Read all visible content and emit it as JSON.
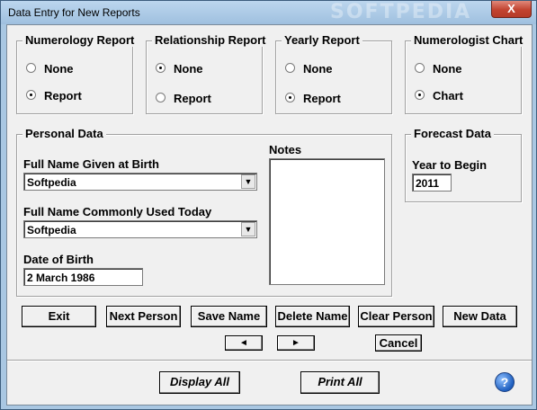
{
  "window": {
    "title": "Data Entry for New Reports",
    "watermark": "SOFTPEDIA",
    "close_glyph": "X"
  },
  "groups": {
    "numerology": {
      "legend": "Numerology Report",
      "options": [
        "None",
        "Report"
      ],
      "selected": "Report"
    },
    "relationship": {
      "legend": "Relationship Report",
      "options": [
        "None",
        "Report"
      ],
      "selected": "None"
    },
    "yearly": {
      "legend": "Yearly Report",
      "options": [
        "None",
        "Report"
      ],
      "selected": "Report"
    },
    "chart": {
      "legend": "Numerologist Chart",
      "options": [
        "None",
        "Chart"
      ],
      "selected": "Chart"
    }
  },
  "personal": {
    "legend": "Personal Data",
    "birth_name_label": "Full Name Given at Birth",
    "birth_name_value": "Softpedia",
    "common_name_label": "Full Name Commonly Used Today",
    "common_name_value": "Softpedia",
    "dob_label": "Date of Birth",
    "dob_value": "2 March 1986",
    "notes_label": "Notes",
    "notes_value": ""
  },
  "forecast": {
    "legend": "Forecast Data",
    "year_label": "Year to Begin",
    "year_value": "2011"
  },
  "buttons": {
    "exit": "Exit",
    "next_person": "Next Person",
    "save_name": "Save Name",
    "delete_name": "Delete Name",
    "clear_person": "Clear Person",
    "new_data": "New Data",
    "prev_arrow": "◄",
    "next_arrow": "►",
    "cancel": "Cancel",
    "display_all": "Display All",
    "print_all": "Print All",
    "help": "?"
  },
  "icons": {
    "dropdown": "chevron-down-icon",
    "help": "help-icon"
  }
}
